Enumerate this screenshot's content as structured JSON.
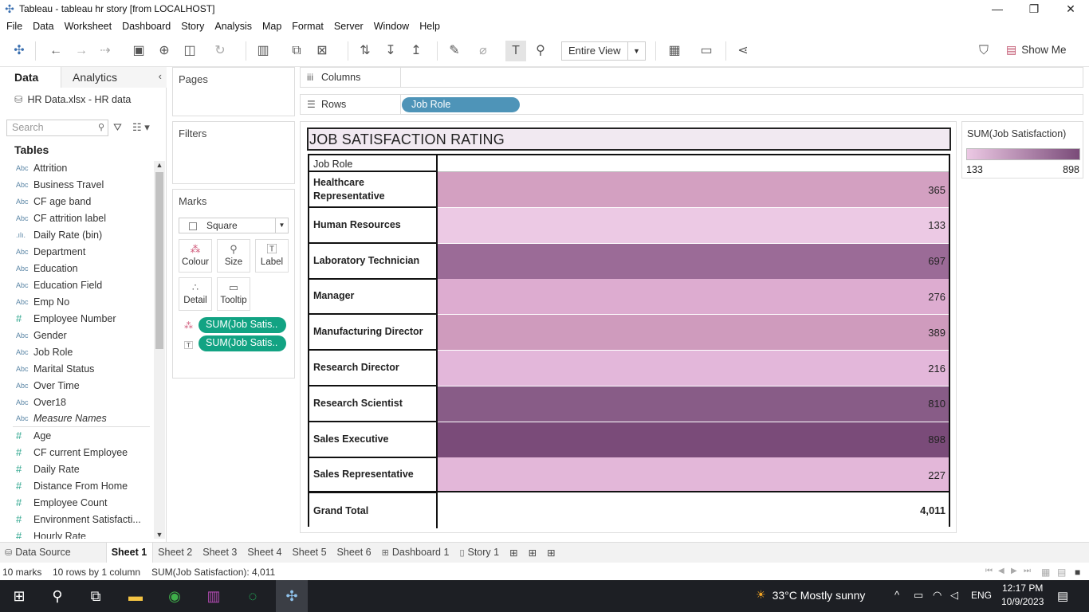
{
  "window": {
    "title": "Tableau - tableau hr story [from LOCALHOST]",
    "minimize": "—",
    "restore": "❐",
    "close": "✕"
  },
  "menu": [
    "File",
    "Data",
    "Worksheet",
    "Dashboard",
    "Story",
    "Analysis",
    "Map",
    "Format",
    "Server",
    "Window",
    "Help"
  ],
  "toolbar": {
    "view_size": "Entire View",
    "show_me": "Show Me"
  },
  "data_pane": {
    "tab_data": "Data",
    "tab_analytics": "Analytics",
    "datasource": "HR Data.xlsx - HR data",
    "search_placeholder": "Search",
    "tables_header": "Tables",
    "fields": [
      {
        "type": "Abc",
        "name": "Attrition"
      },
      {
        "type": "Abc",
        "name": "Business Travel"
      },
      {
        "type": "Abc",
        "name": "CF age band"
      },
      {
        "type": "Abc",
        "name": "CF attrition label"
      },
      {
        "type": ".ılı.",
        "name": "Daily Rate (bin)"
      },
      {
        "type": "Abc",
        "name": "Department"
      },
      {
        "type": "Abc",
        "name": "Education"
      },
      {
        "type": "Abc",
        "name": "Education Field"
      },
      {
        "type": "Abc",
        "name": "Emp No"
      },
      {
        "type": "#",
        "name": "Employee Number"
      },
      {
        "type": "Abc",
        "name": "Gender"
      },
      {
        "type": "Abc",
        "name": "Job Role"
      },
      {
        "type": "Abc",
        "name": "Marital Status"
      },
      {
        "type": "Abc",
        "name": "Over Time"
      },
      {
        "type": "Abc",
        "name": "Over18"
      },
      {
        "type": "Abc",
        "name": "Measure Names"
      },
      {
        "type": "#",
        "name": "Age"
      },
      {
        "type": "#",
        "name": "CF current Employee"
      },
      {
        "type": "#",
        "name": "Daily Rate"
      },
      {
        "type": "#",
        "name": "Distance From Home"
      },
      {
        "type": "#",
        "name": "Employee Count"
      },
      {
        "type": "#",
        "name": "Environment Satisfacti..."
      },
      {
        "type": "#",
        "name": "Hourly Rate"
      }
    ]
  },
  "cards": {
    "pages": "Pages",
    "filters": "Filters",
    "marks": "Marks",
    "mark_type": "Square",
    "buttons": {
      "colour": "Colour",
      "size": "Size",
      "label": "Label",
      "detail": "Detail",
      "tooltip": "Tooltip"
    },
    "pills": [
      "SUM(Job Satis..",
      "SUM(Job Satis.."
    ]
  },
  "shelves": {
    "columns": "Columns",
    "rows": "Rows",
    "rows_pill": "Job Role"
  },
  "view": {
    "title": "JOB SATISFACTION RATING",
    "header": "Job Role",
    "rows": [
      {
        "role": "Healthcare Representative",
        "value": "365",
        "color": "#d3a0c1"
      },
      {
        "role": "Human Resources",
        "value": "133",
        "color": "#ecc9e4"
      },
      {
        "role": "Laboratory Technician",
        "value": "697",
        "color": "#9b6b97"
      },
      {
        "role": "Manager",
        "value": "276",
        "color": "#ddacd0"
      },
      {
        "role": "Manufacturing Director",
        "value": "389",
        "color": "#cf9bbd"
      },
      {
        "role": "Research Director",
        "value": "216",
        "color": "#e3b7da"
      },
      {
        "role": "Research Scientist",
        "value": "810",
        "color": "#885c87"
      },
      {
        "role": "Sales Executive",
        "value": "898",
        "color": "#7a4b79"
      },
      {
        "role": "Sales Representative",
        "value": "227",
        "color": "#e3b7d9"
      }
    ],
    "grand_total_label": "Grand Total",
    "grand_total_value": "4,011"
  },
  "legend": {
    "title": "SUM(Job Satisfaction)",
    "min": "133",
    "max": "898",
    "color_low": "#ecc9e4",
    "color_high": "#7a4b79"
  },
  "tabs": {
    "data_source": "Data Source",
    "sheets": [
      "Sheet 1",
      "Sheet 2",
      "Sheet 3",
      "Sheet 4",
      "Sheet 5",
      "Sheet 6"
    ],
    "dashboard": "Dashboard 1",
    "story": "Story 1"
  },
  "status": {
    "marks": "10 marks",
    "rows": "10 rows by 1 column",
    "sum": "SUM(Job Satisfaction): 4,011"
  },
  "taskbar": {
    "weather": "33°C  Mostly sunny",
    "lang": "ENG",
    "time": "12:17 PM",
    "date": "10/9/2023"
  }
}
